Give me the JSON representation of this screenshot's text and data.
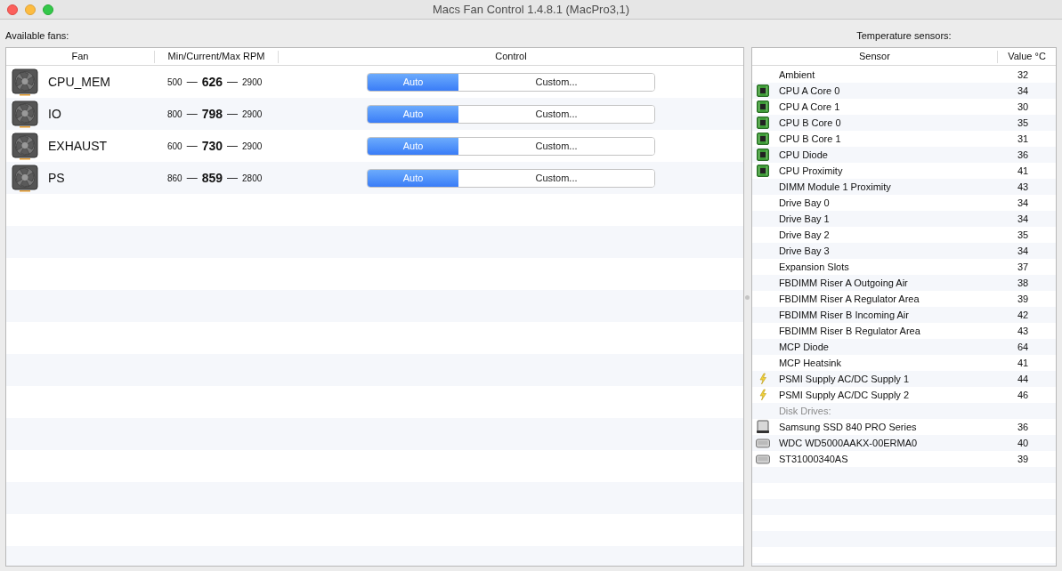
{
  "window": {
    "title": "Macs Fan Control 1.4.8.1 (MacPro3,1)"
  },
  "fans_panel": {
    "label": "Available fans:",
    "columns": [
      "Fan",
      "Min/Current/Max RPM",
      "Control"
    ],
    "fans": [
      {
        "name": "CPU_MEM",
        "min": "500",
        "current": "626",
        "max": "2900",
        "separator": "—",
        "modes": [
          {
            "label": "Auto",
            "selected": true
          },
          {
            "label": "Custom...",
            "selected": false
          }
        ]
      },
      {
        "name": "IO",
        "min": "800",
        "current": "798",
        "max": "2900",
        "separator": "—",
        "modes": [
          {
            "label": "Auto",
            "selected": true
          },
          {
            "label": "Custom...",
            "selected": false
          }
        ]
      },
      {
        "name": "EXHAUST",
        "min": "600",
        "current": "730",
        "max": "2900",
        "separator": "—",
        "modes": [
          {
            "label": "Auto",
            "selected": true
          },
          {
            "label": "Custom...",
            "selected": false
          }
        ]
      },
      {
        "name": "PS",
        "min": "860",
        "current": "859",
        "max": "2800",
        "separator": "—",
        "modes": [
          {
            "label": "Auto",
            "selected": true
          },
          {
            "label": "Custom...",
            "selected": false
          }
        ]
      }
    ]
  },
  "sensors_panel": {
    "label": "Temperature sensors:",
    "columns": [
      "Sensor",
      "Value °C"
    ],
    "sensors": [
      {
        "kind": "plain",
        "name": "Ambient",
        "value": "32"
      },
      {
        "kind": "cpu",
        "name": "CPU A Core 0",
        "value": "34"
      },
      {
        "kind": "cpu",
        "name": "CPU A Core 1",
        "value": "30"
      },
      {
        "kind": "cpu",
        "name": "CPU B Core 0",
        "value": "35"
      },
      {
        "kind": "cpu",
        "name": "CPU B Core 1",
        "value": "31"
      },
      {
        "kind": "cpu",
        "name": "CPU Diode",
        "value": "36"
      },
      {
        "kind": "cpu",
        "name": "CPU Proximity",
        "value": "41"
      },
      {
        "kind": "plain",
        "name": "DIMM Module 1 Proximity",
        "value": "43"
      },
      {
        "kind": "plain",
        "name": "Drive Bay 0",
        "value": "34"
      },
      {
        "kind": "plain",
        "name": "Drive Bay 1",
        "value": "34"
      },
      {
        "kind": "plain",
        "name": "Drive Bay 2",
        "value": "35"
      },
      {
        "kind": "plain",
        "name": "Drive Bay 3",
        "value": "34"
      },
      {
        "kind": "plain",
        "name": "Expansion Slots",
        "value": "37"
      },
      {
        "kind": "plain",
        "name": "FBDIMM Riser A Outgoing Air",
        "value": "38"
      },
      {
        "kind": "plain",
        "name": "FBDIMM Riser A Regulator Area",
        "value": "39"
      },
      {
        "kind": "plain",
        "name": "FBDIMM Riser B Incoming Air",
        "value": "42"
      },
      {
        "kind": "plain",
        "name": "FBDIMM Riser B Regulator Area",
        "value": "43"
      },
      {
        "kind": "plain",
        "name": "MCP Diode",
        "value": "64"
      },
      {
        "kind": "plain",
        "name": "MCP Heatsink",
        "value": "41"
      },
      {
        "kind": "power",
        "name": "PSMI Supply AC/DC Supply 1",
        "value": "44"
      },
      {
        "kind": "power",
        "name": "PSMI Supply AC/DC Supply 2",
        "value": "46"
      },
      {
        "kind": "heading",
        "name": "Disk Drives:"
      },
      {
        "kind": "ssd",
        "name": "Samsung SSD 840 PRO Series",
        "value": "36"
      },
      {
        "kind": "hdd",
        "name": "WDC WD5000AAKX-00ERMA0",
        "value": "40"
      },
      {
        "kind": "hdd",
        "name": "ST31000340AS",
        "value": "39"
      }
    ]
  }
}
